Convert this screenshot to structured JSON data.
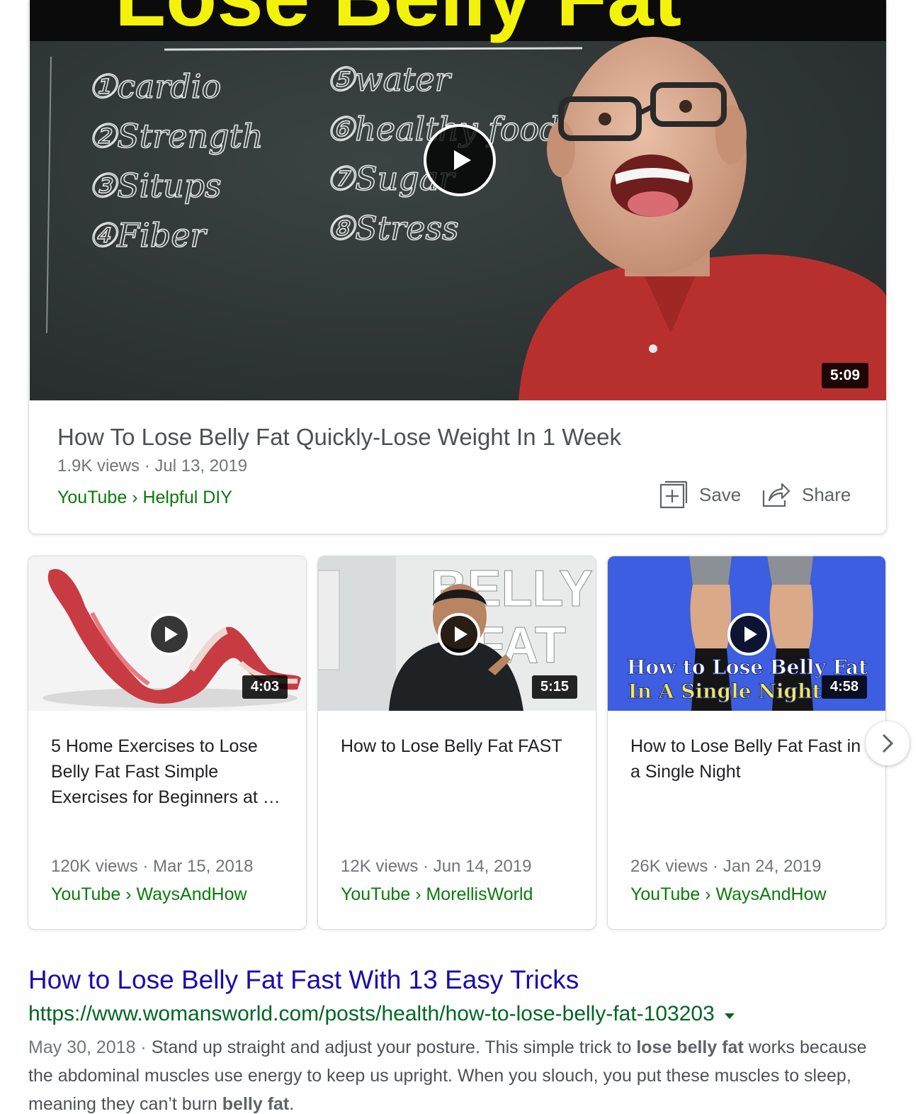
{
  "featured": {
    "thumbnail_banner": "Lose Belly Fat",
    "duration": "5:09",
    "title": "How To Lose Belly Fat Quickly-Lose Weight In 1 Week",
    "meta": "1.9K views · Jul 13, 2019",
    "source": "YouTube › Helpful DIY",
    "save_label": "Save",
    "share_label": "Share",
    "board_items_left": [
      "①cardio",
      "②Strength",
      "③Situps",
      "④Fiber"
    ],
    "board_items_right": [
      "⑤water",
      "⑥healthy foods",
      "⑦Sugar",
      "⑧Stress"
    ]
  },
  "carousel": [
    {
      "duration": "4:03",
      "title": "5 Home Exercises to Lose Belly Fat Fast Simple Exercises for Beginners at …",
      "meta": "120K views · Mar 15, 2018",
      "source": "YouTube › WaysAndHow"
    },
    {
      "duration": "5:15",
      "thumb_text_1": "BELLY",
      "thumb_text_2": "FAT",
      "title": "How to Lose Belly Fat FAST",
      "meta": "12K views · Jun 14, 2019",
      "source": "YouTube › MorellisWorld"
    },
    {
      "duration": "4:58",
      "thumb_text_1": "How to Lose Belly Fat",
      "thumb_text_2": "In A Single Night",
      "title": "How to Lose Belly Fat Fast in a Single Night",
      "meta": "26K views · Jan 24, 2019",
      "source": "YouTube › WaysAndHow"
    }
  ],
  "result": {
    "title": "How to Lose Belly Fat Fast With 13 Easy Tricks",
    "url": "https://www.womansworld.com/posts/health/how-to-lose-belly-fat-103203",
    "date": "May 30, 2018 · ",
    "snippet_1": "Stand up straight and adjust your posture. This simple trick to ",
    "bold_1": "lose belly fat",
    "snippet_2": " works because the abdominal muscles use energy to keep us upright. When you slouch, you put these muscles to sleep, meaning they can’t burn ",
    "bold_2": "belly fat",
    "snippet_3": "."
  },
  "colors": {
    "link": "#1a0dab",
    "url_green": "#006621",
    "source_green": "#0b7a0b",
    "banner_yellow": "#f3f20a"
  }
}
